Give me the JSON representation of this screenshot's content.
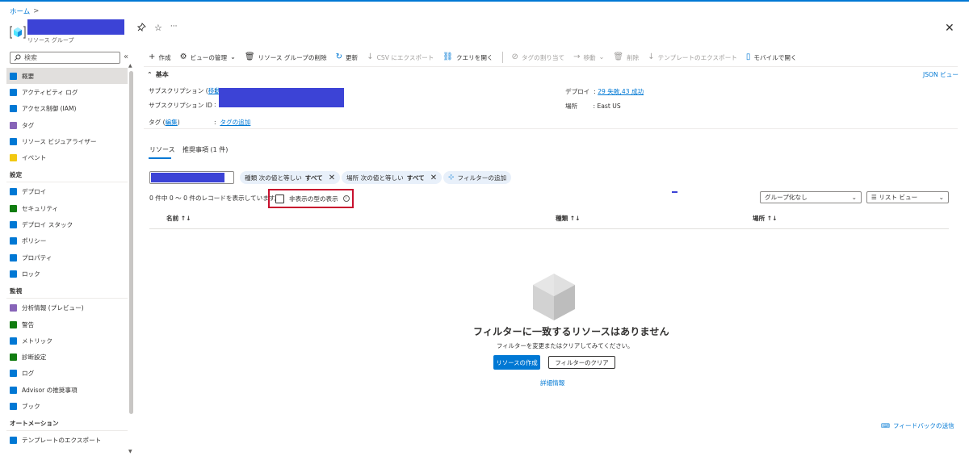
{
  "breadcrumb": {
    "home": "ホーム",
    "sep": ">"
  },
  "header": {
    "subtitle": "リソース グループ",
    "pin_glyph": "✎",
    "star_glyph": "☆",
    "more_glyph": "···",
    "close_glyph": "✕"
  },
  "sidebar": {
    "search_placeholder": "検索",
    "collapse_glyph": "«",
    "items_top": [
      {
        "label": "概要",
        "color": "#0078d4",
        "active": true
      },
      {
        "label": "アクティビティ ログ",
        "color": "#0078d4"
      },
      {
        "label": "アクセス制御 (IAM)",
        "color": "#0078d4"
      },
      {
        "label": "タグ",
        "color": "#8764b8"
      },
      {
        "label": "リソース ビジュアライザー",
        "color": "#0078d4"
      },
      {
        "label": "イベント",
        "color": "#f2c811"
      }
    ],
    "section_settings": "設定",
    "items_settings": [
      {
        "label": "デプロイ",
        "color": "#0078d4"
      },
      {
        "label": "セキュリティ",
        "color": "#107c10"
      },
      {
        "label": "デプロイ スタック",
        "color": "#0078d4"
      },
      {
        "label": "ポリシー",
        "color": "#0078d4"
      },
      {
        "label": "プロパティ",
        "color": "#0078d4"
      },
      {
        "label": "ロック",
        "color": "#0078d4"
      }
    ],
    "section_monitor": "監視",
    "items_monitor": [
      {
        "label": "分析情報 (プレビュー)",
        "color": "#8764b8"
      },
      {
        "label": "警告",
        "color": "#107c10"
      },
      {
        "label": "メトリック",
        "color": "#0078d4"
      },
      {
        "label": "診断設定",
        "color": "#107c10"
      },
      {
        "label": "ログ",
        "color": "#0078d4"
      },
      {
        "label": "Advisor の推奨事項",
        "color": "#0078d4"
      },
      {
        "label": "ブック",
        "color": "#0078d4"
      }
    ],
    "section_automation": "オートメーション",
    "items_automation": [
      {
        "label": "テンプレートのエクスポート",
        "color": "#0078d4"
      }
    ]
  },
  "toolbar": {
    "create": "作成",
    "manage_view": "ビューの管理",
    "delete_rg": "リソース グループの削除",
    "refresh": "更新",
    "export_csv": "CSV にエクスポート",
    "open_query": "クエリを開く",
    "assign_tags": "タグの割り当て",
    "move": "移動",
    "delete": "削除",
    "export_template": "テンプレートのエクスポート",
    "open_mobile": "モバイルで開く"
  },
  "essentials": {
    "title": "基本",
    "json_view": "JSON ビュー",
    "subscription_label": "サブスクリプション",
    "subscription_move": "移動",
    "subscription_id_label": "サブスクリプション ID",
    "tags_label": "タグ",
    "tags_edit": "編集",
    "tags_add": "タグの追加",
    "deploy_label": "デプロイ",
    "deploy_value": "29 失敗,43 成功",
    "location_label": "場所",
    "location_value": "East US"
  },
  "tabs": {
    "resources": "リソース",
    "recommendations": "推奨事項 (1 件)"
  },
  "filters": {
    "type_pill": {
      "prefix": "種類 次の値と等しい",
      "value": "すべて"
    },
    "location_pill": {
      "prefix": "場所 次の値と等しい",
      "value": "すべて"
    },
    "add_filter": "フィルターの追加"
  },
  "records_text": "0 件中 0 〜 0 件のレコードを表示しています。",
  "show_hidden": "非表示の型の表示",
  "grouping": "グループ化なし",
  "view_mode": "リスト ビュー",
  "columns": {
    "name": "名前",
    "type": "種類",
    "location": "場所"
  },
  "empty": {
    "title": "フィルターに一致するリソースはありません",
    "subtitle": "フィルターを変更またはクリアしてみてください。",
    "create_button": "リソースの作成",
    "clear_button": "フィルターのクリア",
    "learn_more": "詳細情報"
  },
  "feedback": "フィードバックの送信"
}
